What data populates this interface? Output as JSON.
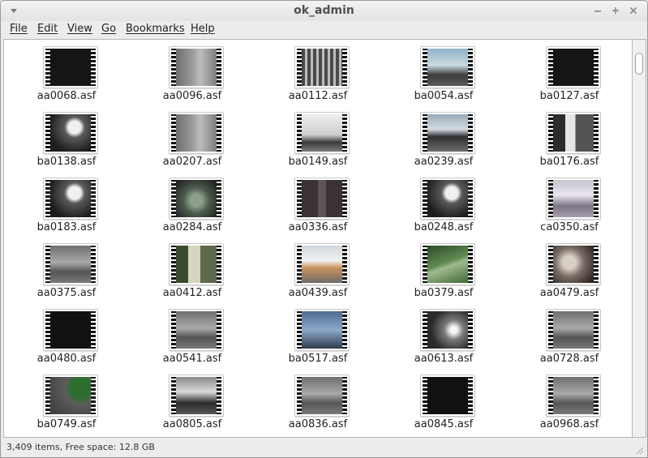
{
  "window": {
    "title": "ok_admin"
  },
  "menu": [
    {
      "label": "File"
    },
    {
      "label": "Edit"
    },
    {
      "label": "View"
    },
    {
      "label": "Go"
    },
    {
      "label": "Bookmarks"
    },
    {
      "label": "Help"
    }
  ],
  "files": [
    {
      "name": "aa0068.asf",
      "thumb": "dark"
    },
    {
      "name": "aa0096.asf",
      "thumb": "gray-door"
    },
    {
      "name": "aa0112.asf",
      "thumb": "crib"
    },
    {
      "name": "ba0054.asf",
      "thumb": "living-room"
    },
    {
      "name": "ba0127.asf",
      "thumb": "dark"
    },
    {
      "name": "ba0138.asf",
      "thumb": "room-bright"
    },
    {
      "name": "aa0207.asf",
      "thumb": "gray-door"
    },
    {
      "name": "ba0149.asf",
      "thumb": "office"
    },
    {
      "name": "aa0239.asf",
      "thumb": "kitchen"
    },
    {
      "name": "ba0176.asf",
      "thumb": "shelf"
    },
    {
      "name": "ba0183.asf",
      "thumb": "room-bright"
    },
    {
      "name": "aa0284.asf",
      "thumb": "garden"
    },
    {
      "name": "aa0336.asf",
      "thumb": "dim-room"
    },
    {
      "name": "ba0248.asf",
      "thumb": "room-bright"
    },
    {
      "name": "ca0350.asf",
      "thumb": "bedroom"
    },
    {
      "name": "aa0375.asf",
      "thumb": "gray-room"
    },
    {
      "name": "aa0412.asf",
      "thumb": "patio"
    },
    {
      "name": "aa0439.asf",
      "thumb": "desk"
    },
    {
      "name": "ba0379.asf",
      "thumb": "lawn"
    },
    {
      "name": "aa0479.asf",
      "thumb": "clutter"
    },
    {
      "name": "aa0480.asf",
      "thumb": "crib-green"
    },
    {
      "name": "aa0541.asf",
      "thumb": "gray-room"
    },
    {
      "name": "ba0517.asf",
      "thumb": "path"
    },
    {
      "name": "aa0613.asf",
      "thumb": "night-flash"
    },
    {
      "name": "aa0728.asf",
      "thumb": "gray-room"
    },
    {
      "name": "ba0749.asf",
      "thumb": "green-blob"
    },
    {
      "name": "aa0805.asf",
      "thumb": "sofa"
    },
    {
      "name": "aa0836.asf",
      "thumb": "gray-room"
    },
    {
      "name": "aa0845.asf",
      "thumb": "crib-green"
    },
    {
      "name": "aa0968.asf",
      "thumb": "gray-room"
    }
  ],
  "status": {
    "text": "3,409 items, Free space: 12.8 GB"
  },
  "colors": {
    "window_bg": "#ececec",
    "content_bg": "#ffffff",
    "text": "#222222"
  }
}
